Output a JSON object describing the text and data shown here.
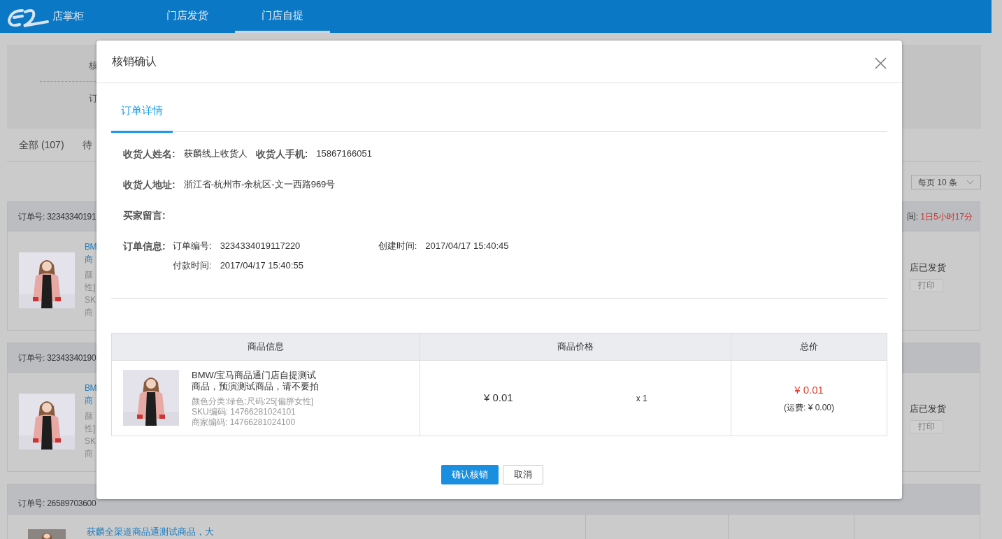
{
  "header": {
    "logo_text": "店掌柜",
    "nav": [
      {
        "label": "门店发货",
        "selected": false
      },
      {
        "label": "门店自提",
        "selected": true
      }
    ]
  },
  "background": {
    "panel_fragments": [
      "核",
      "订"
    ],
    "tabs": [
      "全部 (107)",
      "待"
    ],
    "page_size": "每页 10 条",
    "orders": [
      {
        "order_no": "订单号: 32343340191",
        "timer_label": "间:",
        "timer_value": "1日5小时17分",
        "title_fragments": [
          "BM",
          "商"
        ],
        "spec_fragments": [
          "颜",
          "性]",
          "SK",
          "商"
        ],
        "status": "店已发货",
        "print_button": "打印"
      },
      {
        "order_no": "订单号: 32343340190",
        "title_fragments": [
          "BM",
          "商"
        ],
        "spec_fragments": [
          "颜",
          "性]",
          "SK",
          "商"
        ],
        "status": "店已发货",
        "print_button": "打印"
      }
    ],
    "last_order": {
      "order_no": "订单号: 26589703600",
      "title": "获麟全渠道商品通测试商品，大"
    }
  },
  "modal": {
    "title": "核销确认",
    "tabs": [
      {
        "label": "订单详情",
        "selected": true
      }
    ],
    "receiver_name_label": "收货人姓名:",
    "receiver_name": "获麟线上收货人",
    "receiver_phone_label": "收货人手机:",
    "receiver_phone": "15867166051",
    "address_label": "收货人地址:",
    "address": "浙江省-杭州市-余杭区-文一西路969号",
    "message_label": "买家留言:",
    "order_info_label": "订单信息:",
    "order_no_label": "订单编号:",
    "order_no": "3234334019117220",
    "created_label": "创建时间:",
    "created": "2017/04/17 15:40:45",
    "paid_label": "付款时间:",
    "paid": "2017/04/17 15:40:55",
    "table": {
      "columns": [
        "商品信息",
        "商品价格",
        "总价"
      ],
      "rows": [
        {
          "title": "BMW/宝马商品通门店自提测试商品，预演测试商品，请不要拍",
          "specs": [
            "颜色分类:绿色;尺码:25[偏胖女性]",
            "SKU编码: 14766281024101",
            "商家编码: 14766281024100"
          ],
          "price": "¥ 0.01",
          "quantity": "x 1",
          "total": "¥ 0.01",
          "shipping": "(运费: ¥ 0.00)"
        }
      ]
    },
    "buttons": [
      {
        "label": "确认核销",
        "kind": "primary"
      },
      {
        "label": "取消",
        "kind": "secondary"
      }
    ]
  }
}
